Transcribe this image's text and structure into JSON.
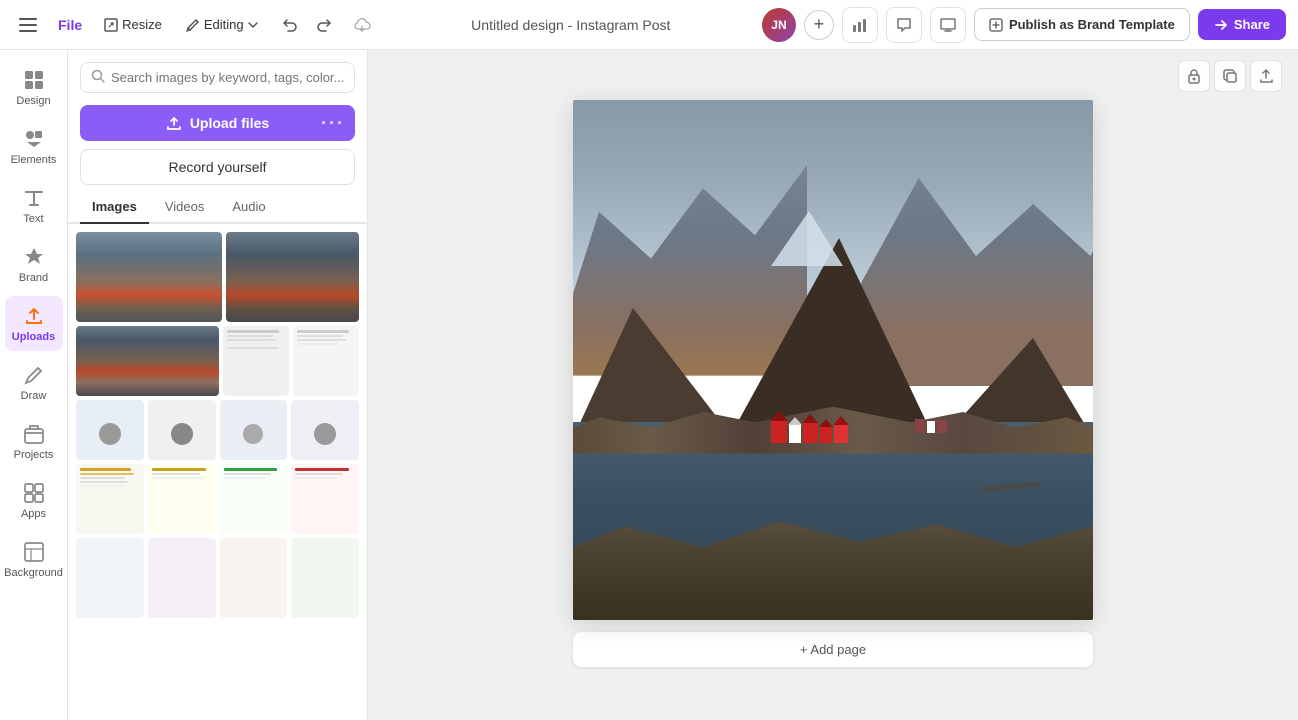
{
  "topbar": {
    "hamburger_icon": "☰",
    "file_label": "File",
    "resize_label": "Resize",
    "editing_label": "Editing",
    "undo_icon": "↩",
    "redo_icon": "↪",
    "cloud_icon": "☁",
    "title": "Untitled design - Instagram Post",
    "avatar_initials": "JN",
    "add_icon": "+",
    "chart_icon": "📊",
    "comment_icon": "💬",
    "present_icon": "⬜",
    "publish_label": "Publish as Brand Template",
    "share_label": "Share"
  },
  "sidebar": {
    "items": [
      {
        "id": "design",
        "label": "Design",
        "icon": "⊞"
      },
      {
        "id": "elements",
        "label": "Elements",
        "icon": "✦"
      },
      {
        "id": "text",
        "label": "Text",
        "icon": "T"
      },
      {
        "id": "brand",
        "label": "Brand",
        "icon": "◈"
      },
      {
        "id": "uploads",
        "label": "Uploads",
        "icon": "⬆",
        "active": true
      },
      {
        "id": "draw",
        "label": "Draw",
        "icon": "✏"
      },
      {
        "id": "projects",
        "label": "Projects",
        "icon": "▣"
      },
      {
        "id": "apps",
        "label": "Apps",
        "icon": "⊞"
      },
      {
        "id": "background",
        "label": "Background",
        "icon": "▦"
      }
    ]
  },
  "panel": {
    "search_placeholder": "Search images by keyword, tags, color...",
    "upload_label": "Upload files",
    "upload_dots": "···",
    "record_label": "Record yourself",
    "tabs": [
      {
        "id": "images",
        "label": "Images",
        "active": true
      },
      {
        "id": "videos",
        "label": "Videos"
      },
      {
        "id": "audio",
        "label": "Audio"
      }
    ]
  },
  "canvas": {
    "title": "Untitled design - Instagram Post",
    "lock_icon": "🔒",
    "copy_icon": "⧉",
    "export_icon": "↗",
    "add_page_label": "+ Add page"
  }
}
